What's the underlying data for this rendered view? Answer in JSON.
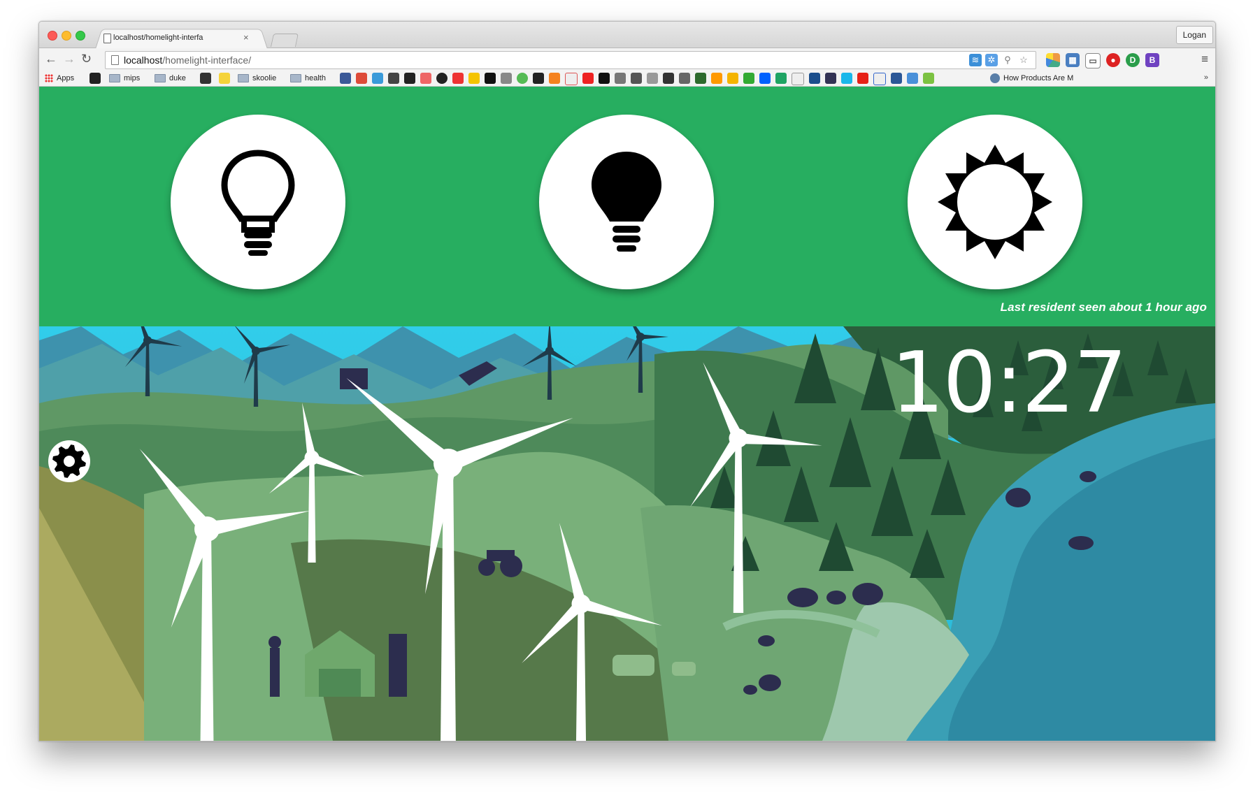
{
  "browser": {
    "tab_title": "localhost/homelight-interfa",
    "tab_close": "×",
    "profile_name": "Logan",
    "url_host": "localhost",
    "url_path": "/homelight-interface/",
    "nav": {
      "back": "←",
      "forward": "→",
      "reload": "↻"
    },
    "menu": "≡",
    "bookmarks": {
      "apps": "Apps",
      "folders": [
        "mips",
        "duke",
        "skoolie",
        "health"
      ],
      "last": "How Products Are M",
      "more": "»"
    }
  },
  "app": {
    "controls": [
      {
        "name": "light-off",
        "icon": "lightbulb-outline-icon"
      },
      {
        "name": "light-on",
        "icon": "lightbulb-filled-icon"
      },
      {
        "name": "sunlight",
        "icon": "sun-icon"
      }
    ],
    "status_text": "Last resident seen about 1 hour ago",
    "clock": "10:27",
    "settings_icon": "gear-icon",
    "colors": {
      "header": "#27ae60",
      "sky": "#2ecbe8",
      "lake": "#3a9fb5"
    }
  }
}
